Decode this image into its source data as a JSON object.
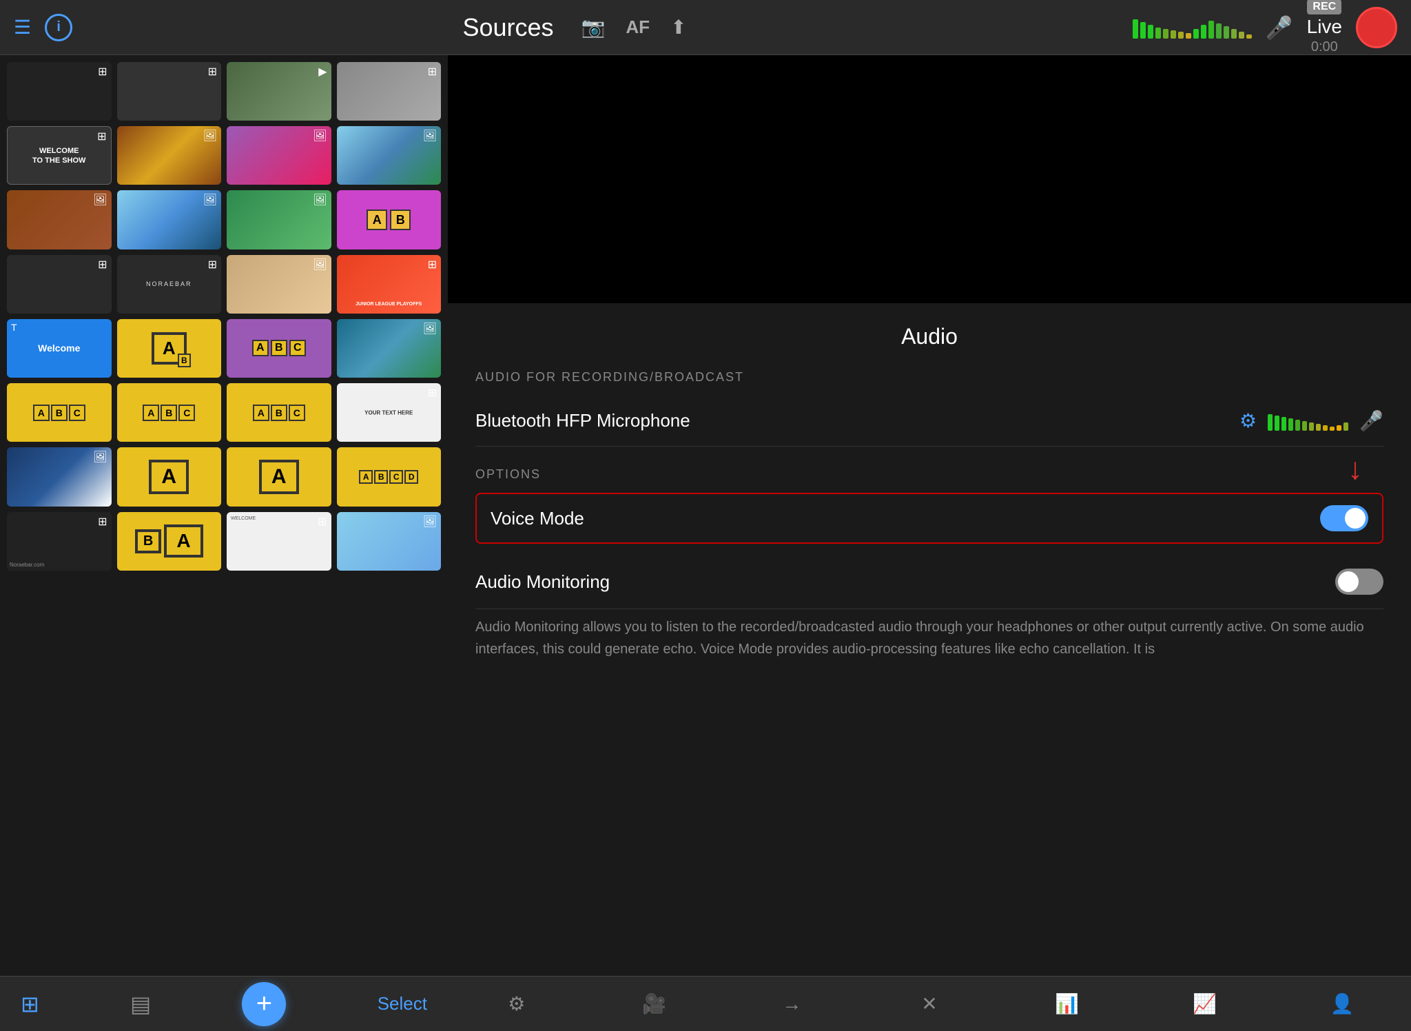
{
  "header": {
    "title": "Sources",
    "af_label": "AF",
    "live_label": "Live",
    "timer": "0:00",
    "rec_badge": "REC"
  },
  "audio": {
    "title": "Audio",
    "section_recording": "AUDIO FOR RECORDING/BROADCAST",
    "device_name": "Bluetooth HFP Microphone",
    "section_options": "OPTIONS",
    "voice_mode_label": "Voice Mode",
    "audio_monitoring_label": "Audio Monitoring",
    "description": "Audio Monitoring allows you to listen to the recorded/broadcasted audio through your headphones or other output currently active. On some audio interfaces, this could generate echo.\nVoice Mode provides audio-processing features like echo cancellation. It is"
  },
  "sources_grid": {
    "thumbs": [
      {
        "id": "t1",
        "type": "live-bar"
      },
      {
        "id": "t2",
        "type": "score-overlay"
      },
      {
        "id": "t3",
        "type": "crowd"
      },
      {
        "id": "t4",
        "type": "emma"
      },
      {
        "id": "t5",
        "type": "welcome",
        "text": "WELCOME\nTO THE SHOW"
      },
      {
        "id": "t6",
        "type": "concert"
      },
      {
        "id": "t7",
        "type": "event"
      },
      {
        "id": "t8",
        "type": "city-day"
      },
      {
        "id": "t9",
        "type": "building"
      },
      {
        "id": "t10",
        "type": "city2"
      },
      {
        "id": "t11",
        "type": "green"
      },
      {
        "id": "t12",
        "type": "ab"
      },
      {
        "id": "t13",
        "type": "noraebar"
      },
      {
        "id": "t14",
        "type": "noraebar2"
      },
      {
        "id": "t15",
        "type": "soup"
      },
      {
        "id": "t16",
        "type": "junior-league",
        "text": "JUNIOR LEAGUE PLAYOFFS"
      },
      {
        "id": "t17",
        "type": "welcome-blue",
        "text": "Welcome"
      },
      {
        "id": "t18",
        "type": "a-single"
      },
      {
        "id": "t19",
        "type": "abc-purple"
      },
      {
        "id": "t20",
        "type": "lake"
      },
      {
        "id": "t21",
        "type": "abc-row"
      },
      {
        "id": "t22",
        "type": "abc-row2"
      },
      {
        "id": "t23",
        "type": "abc-row3"
      },
      {
        "id": "t24",
        "type": "your-text",
        "text": "YOUR TEXT HERE"
      },
      {
        "id": "t25",
        "type": "wave"
      },
      {
        "id": "t26",
        "type": "a-big"
      },
      {
        "id": "t27",
        "type": "a-big2"
      },
      {
        "id": "t28",
        "type": "abcd"
      },
      {
        "id": "t29",
        "type": "noraebar3"
      },
      {
        "id": "t30",
        "type": "b-a"
      },
      {
        "id": "t31",
        "type": "welcome-small"
      },
      {
        "id": "t32",
        "type": "family"
      }
    ]
  },
  "bottom_bar": {
    "select_label": "Select",
    "add_label": "+"
  }
}
